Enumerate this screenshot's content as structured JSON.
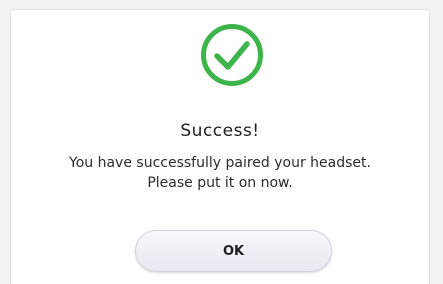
{
  "dialog": {
    "icon": "checkmark-circle-icon",
    "title": "Success!",
    "message_line1": "You have successfully paired your headset.",
    "message_line2": "Please put it on now.",
    "ok_label": "OK"
  },
  "colors": {
    "success_green": "#3db54a",
    "text": "#1e1e1e"
  }
}
